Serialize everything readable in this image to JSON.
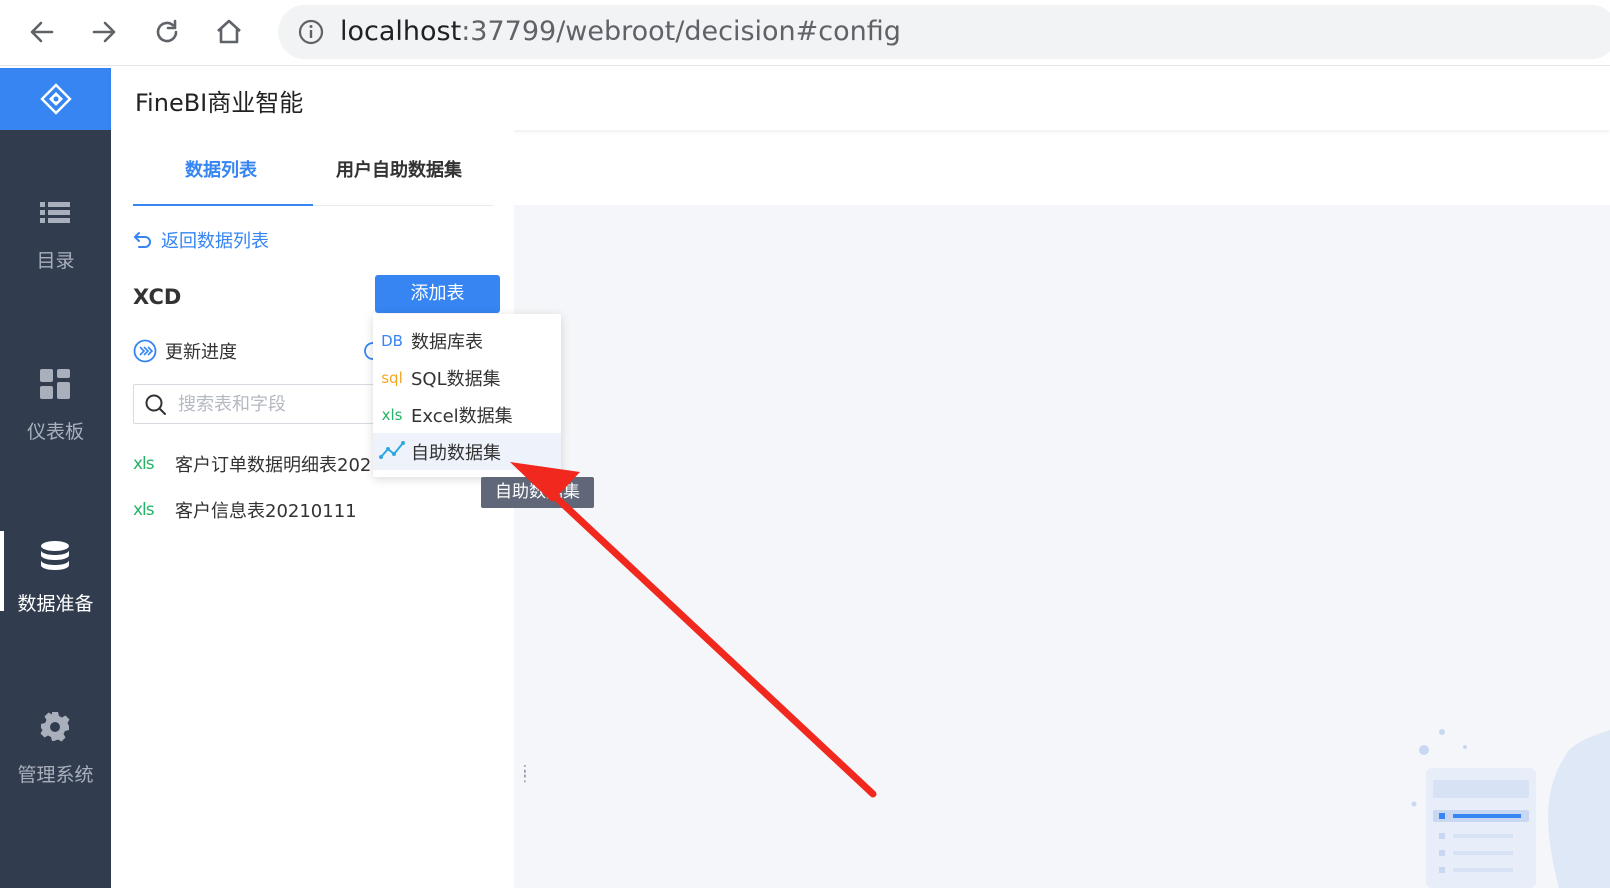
{
  "browser": {
    "url_host": "localhost",
    "url_rest": ":37799/webroot/decision#config",
    "back_icon": "arrow-left-icon",
    "forward_icon": "arrow-right-icon",
    "reload_icon": "reload-icon",
    "home_icon": "home-icon",
    "info_icon": "info-icon"
  },
  "app": {
    "title": "FineBI商业智能",
    "brand_color": "#3685f2",
    "nav_bg": "#323c4f"
  },
  "sidebar": {
    "items": [
      {
        "label": "目录",
        "icon": "list-icon",
        "active": false
      },
      {
        "label": "仪表板",
        "icon": "dashboard-icon",
        "active": false
      },
      {
        "label": "数据准备",
        "icon": "database-icon",
        "active": true
      },
      {
        "label": "管理系统",
        "icon": "gear-icon",
        "active": false
      }
    ]
  },
  "tabs": [
    {
      "label": "数据列表",
      "active": true
    },
    {
      "label": "用户自助数据集",
      "active": false
    }
  ],
  "panel": {
    "back_label": "返回数据列表",
    "package_name": "XCD",
    "add_table_label": "添加表",
    "update_label": "更新进度",
    "search_placeholder": "搜索表和字段",
    "tables": [
      {
        "type": "xls",
        "name": "客户订单数据明细表202"
      },
      {
        "type": "xls",
        "name": "客户信息表20210111"
      }
    ]
  },
  "dropdown": {
    "items": [
      {
        "tag": "DB",
        "label": "数据库表",
        "tag_color": "#3685f2"
      },
      {
        "tag": "sql",
        "label": "SQL数据集",
        "tag_color": "#f5a623"
      },
      {
        "tag": "xls",
        "label": "Excel数据集",
        "tag_color": "#26b368"
      },
      {
        "tag": "",
        "label": "自助数据集",
        "tag_color": "#3685f2"
      }
    ],
    "tooltip": "自助数据集"
  }
}
